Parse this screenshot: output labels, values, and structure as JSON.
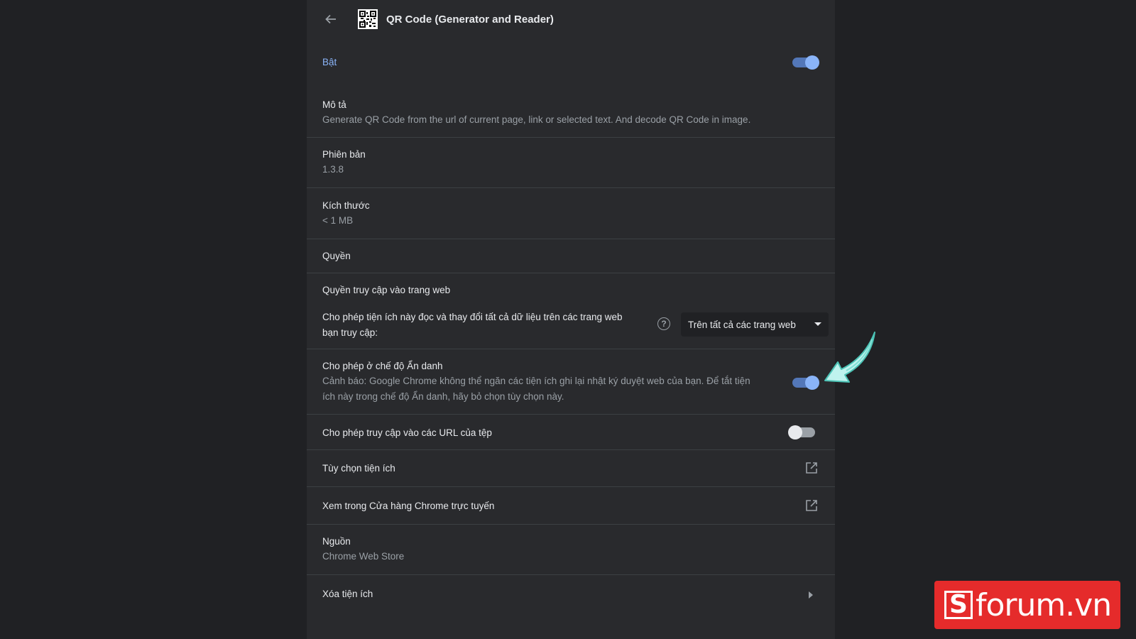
{
  "header": {
    "title": "QR Code (Generator and Reader)",
    "back_icon": "arrow-left-icon",
    "extension_icon": "qr-code-icon"
  },
  "enabled": {
    "label": "Bật",
    "on": true
  },
  "description": {
    "label": "Mô tả",
    "value": "Generate QR Code from the url of current page, link or selected text. And decode QR Code in image."
  },
  "version": {
    "label": "Phiên bản",
    "value": "1.3.8"
  },
  "size": {
    "label": "Kích thước",
    "value": "< 1 MB"
  },
  "permissions": {
    "label": "Quyền"
  },
  "site_access": {
    "heading": "Quyền truy cập vào trang web",
    "description_line1": "Cho phép tiện ích này đọc và thay đổi tất cả dữ liệu trên các trang web",
    "description_line2": "bạn truy cập:",
    "help_icon": "help-circle-icon",
    "selected": "Trên tất cả các trang web"
  },
  "incognito": {
    "label": "Cho phép ở chế độ Ẩn danh",
    "warning_line1": "Cảnh báo: Google Chrome không thể ngăn các tiện ích ghi lại nhật ký duyệt web của bạn. Để tắt tiện",
    "warning_line2": "ích này trong chế độ Ẩn danh, hãy bỏ chọn tùy chọn này.",
    "on": true
  },
  "file_urls": {
    "label": "Cho phép truy cập vào các URL của tệp",
    "on": false
  },
  "extension_options": {
    "label": "Tùy chọn tiện ích",
    "icon": "open-in-new-icon"
  },
  "web_store_link": {
    "label": "Xem trong Cửa hàng Chrome trực tuyến",
    "icon": "open-in-new-icon"
  },
  "source": {
    "label": "Nguồn",
    "value": "Chrome Web Store"
  },
  "remove": {
    "label": "Xóa tiện ích",
    "icon": "chevron-right-icon"
  },
  "watermark": {
    "text": "forum.vn",
    "mark": "S",
    "background": "#e52b2b"
  },
  "colors": {
    "page_bg": "#202124",
    "panel_bg": "#292a2d",
    "accent": "#8ab4f8",
    "toggle_track_on": "#5377b8",
    "divider": "#3c4043",
    "annotation_arrow": "#7ee0d4"
  }
}
